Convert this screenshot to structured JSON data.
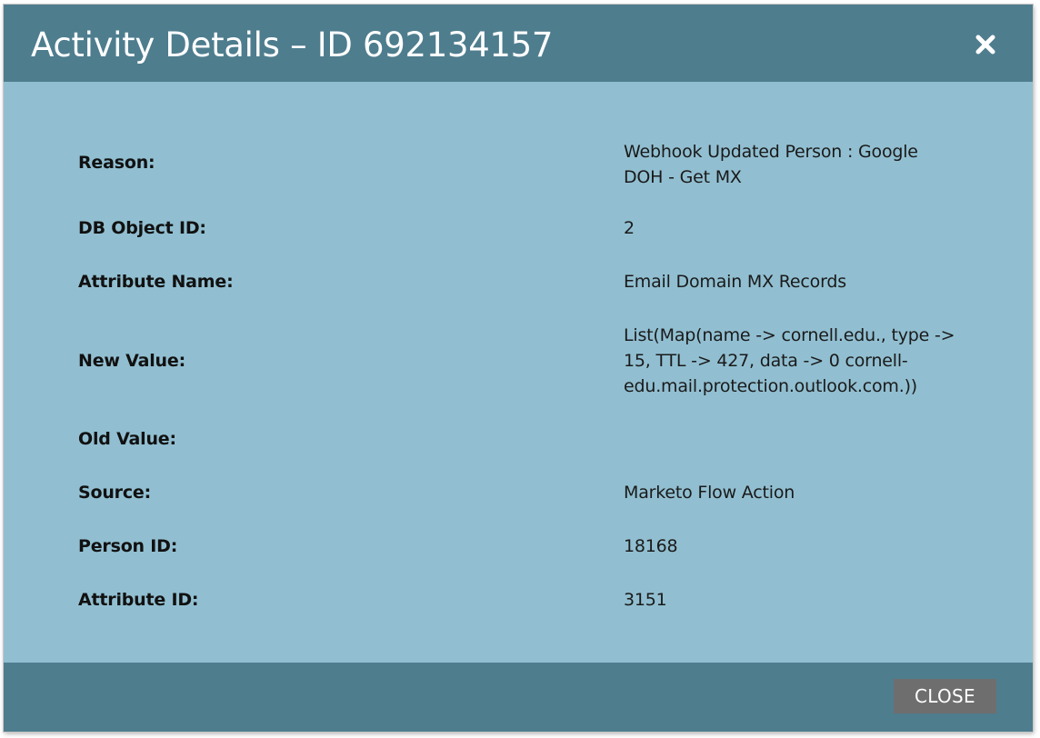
{
  "dialog": {
    "title": "Activity Details – ID 692134157",
    "close_icon": "close-icon"
  },
  "details": [
    {
      "label": "Reason:",
      "value": "Webhook Updated Person : Google DOH - Get MX"
    },
    {
      "label": "DB Object ID:",
      "value": "2"
    },
    {
      "label": "Attribute Name:",
      "value": "Email Domain MX Records"
    },
    {
      "label": "New Value:",
      "value": "List(Map(name -> cornell.edu., type -> 15, TTL -> 427, data -> 0 cornell-edu.mail.protection.outlook.com.))"
    },
    {
      "label": "Old Value:",
      "value": ""
    },
    {
      "label": "Source:",
      "value": "Marketo Flow Action"
    },
    {
      "label": "Person ID:",
      "value": "18168"
    },
    {
      "label": "Attribute ID:",
      "value": "3151"
    }
  ],
  "footer": {
    "close_label": "CLOSE"
  },
  "colors": {
    "header_bg": "#4e7d8e",
    "body_bg": "#91bfd1",
    "button_bg": "#6e6e6e"
  }
}
